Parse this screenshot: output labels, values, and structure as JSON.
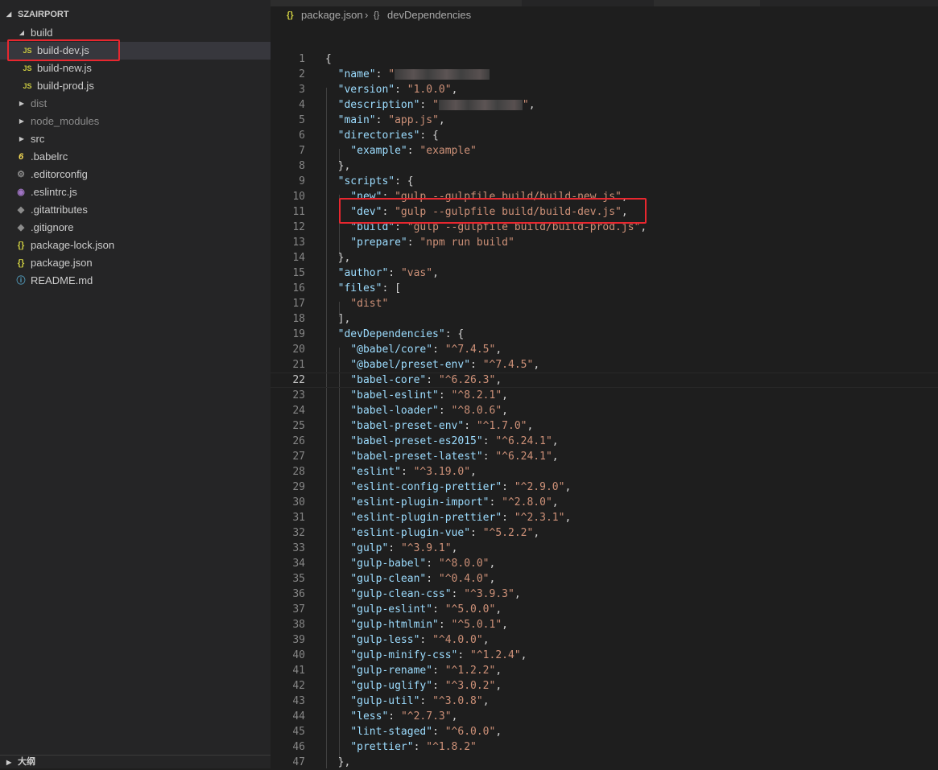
{
  "explorer": {
    "project_name": "SZAIRPORT",
    "outline_label": "大纲",
    "tree": [
      {
        "name": "build",
        "type": "folder-open",
        "icon": "chevron-down-icon",
        "depth": 1
      },
      {
        "name": "build-dev.js",
        "type": "file",
        "icon_text": "JS",
        "icon": "js-file-icon",
        "depth": 2,
        "selected": true
      },
      {
        "name": "build-new.js",
        "type": "file",
        "icon_text": "JS",
        "icon": "js-file-icon",
        "depth": 2
      },
      {
        "name": "build-prod.js",
        "type": "file",
        "icon_text": "JS",
        "icon": "js-file-icon",
        "depth": 2
      },
      {
        "name": "dist",
        "type": "folder",
        "icon": "chevron-right-icon",
        "depth": 1,
        "dim": true
      },
      {
        "name": "node_modules",
        "type": "folder",
        "icon": "chevron-right-icon",
        "depth": 1,
        "dim": true
      },
      {
        "name": "src",
        "type": "folder",
        "icon": "chevron-right-icon",
        "depth": 1
      },
      {
        "name": ".babelrc",
        "type": "file",
        "icon_text": "6",
        "icon": "babel-icon",
        "depth": 1
      },
      {
        "name": ".editorconfig",
        "type": "file",
        "icon_text": "⚙",
        "icon": "gear-icon",
        "depth": 1
      },
      {
        "name": ".eslintrc.js",
        "type": "file",
        "icon_text": "◉",
        "icon": "eslint-icon",
        "depth": 1
      },
      {
        "name": ".gitattributes",
        "type": "file",
        "icon_text": "◆",
        "icon": "git-icon",
        "depth": 1
      },
      {
        "name": ".gitignore",
        "type": "file",
        "icon_text": "◆",
        "icon": "git-icon",
        "depth": 1
      },
      {
        "name": "package-lock.json",
        "type": "file",
        "icon_text": "{}",
        "icon": "json-icon",
        "depth": 1
      },
      {
        "name": "package.json",
        "type": "file",
        "icon_text": "{}",
        "icon": "json-icon",
        "depth": 1
      },
      {
        "name": "README.md",
        "type": "file",
        "icon_text": "ⓘ",
        "icon": "info-icon",
        "depth": 1
      }
    ]
  },
  "breadcrumbs": {
    "file_icon": "{}",
    "file": "package.json",
    "separator": "›",
    "symbol_icon": "{}",
    "symbol": "devDependencies"
  },
  "editor": {
    "current_line": 22,
    "lines": [
      {
        "n": "1",
        "code": "{"
      },
      {
        "n": "2",
        "code": "  \"name\": \"",
        "redacted": true
      },
      {
        "n": "3",
        "code": "  \"version\": \"1.0.0\","
      },
      {
        "n": "4",
        "code": "  \"description\": \"",
        "redacted": true,
        "after": "\","
      },
      {
        "n": "5",
        "code": "  \"main\": \"app.js\","
      },
      {
        "n": "6",
        "code": "  \"directories\": {"
      },
      {
        "n": "7",
        "code": "    \"example\": \"example\""
      },
      {
        "n": "8",
        "code": "  },"
      },
      {
        "n": "9",
        "code": "  \"scripts\": {"
      },
      {
        "n": "10",
        "code": "    \"new\": \"gulp --gulpfile build/build-new.js\","
      },
      {
        "n": "11",
        "code": "    \"dev\": \"gulp --gulpfile build/build-dev.js\","
      },
      {
        "n": "12",
        "code": "    \"build\": \"gulp --gulpfile build/build-prod.js\","
      },
      {
        "n": "13",
        "code": "    \"prepare\": \"npm run build\""
      },
      {
        "n": "14",
        "code": "  },"
      },
      {
        "n": "15",
        "code": "  \"author\": \"vas\","
      },
      {
        "n": "16",
        "code": "  \"files\": ["
      },
      {
        "n": "17",
        "code": "    \"dist\""
      },
      {
        "n": "18",
        "code": "  ],"
      },
      {
        "n": "19",
        "code": "  \"devDependencies\": {"
      },
      {
        "n": "20",
        "code": "    \"@babel/core\": \"^7.4.5\","
      },
      {
        "n": "21",
        "code": "    \"@babel/preset-env\": \"^7.4.5\","
      },
      {
        "n": "22",
        "code": "    \"babel-core\": \"^6.26.3\","
      },
      {
        "n": "23",
        "code": "    \"babel-eslint\": \"^8.2.1\","
      },
      {
        "n": "24",
        "code": "    \"babel-loader\": \"^8.0.6\","
      },
      {
        "n": "25",
        "code": "    \"babel-preset-env\": \"^1.7.0\","
      },
      {
        "n": "26",
        "code": "    \"babel-preset-es2015\": \"^6.24.1\","
      },
      {
        "n": "27",
        "code": "    \"babel-preset-latest\": \"^6.24.1\","
      },
      {
        "n": "28",
        "code": "    \"eslint\": \"^3.19.0\","
      },
      {
        "n": "29",
        "code": "    \"eslint-config-prettier\": \"^2.9.0\","
      },
      {
        "n": "30",
        "code": "    \"eslint-plugin-import\": \"^2.8.0\","
      },
      {
        "n": "31",
        "code": "    \"eslint-plugin-prettier\": \"^2.3.1\","
      },
      {
        "n": "32",
        "code": "    \"eslint-plugin-vue\": \"^5.2.2\","
      },
      {
        "n": "33",
        "code": "    \"gulp\": \"^3.9.1\","
      },
      {
        "n": "34",
        "code": "    \"gulp-babel\": \"^8.0.0\","
      },
      {
        "n": "35",
        "code": "    \"gulp-clean\": \"^0.4.0\","
      },
      {
        "n": "36",
        "code": "    \"gulp-clean-css\": \"^3.9.3\","
      },
      {
        "n": "37",
        "code": "    \"gulp-eslint\": \"^5.0.0\","
      },
      {
        "n": "38",
        "code": "    \"gulp-htmlmin\": \"^5.0.1\","
      },
      {
        "n": "39",
        "code": "    \"gulp-less\": \"^4.0.0\","
      },
      {
        "n": "40",
        "code": "    \"gulp-minify-css\": \"^1.2.4\","
      },
      {
        "n": "41",
        "code": "    \"gulp-rename\": \"^1.2.2\","
      },
      {
        "n": "42",
        "code": "    \"gulp-uglify\": \"^3.0.2\","
      },
      {
        "n": "43",
        "code": "    \"gulp-util\": \"^3.0.8\","
      },
      {
        "n": "44",
        "code": "    \"less\": \"^2.7.3\","
      },
      {
        "n": "45",
        "code": "    \"lint-staged\": \"^6.0.0\","
      },
      {
        "n": "46",
        "code": "    \"prettier\": \"^1.8.2\""
      },
      {
        "n": "47",
        "code": "  },"
      }
    ]
  },
  "colors": {
    "annotation_box": "#e8272f",
    "json_key": "#9cdcfe",
    "json_string": "#ce9178",
    "editor_bg": "#1e1e1e",
    "sidebar_bg": "#252526"
  }
}
